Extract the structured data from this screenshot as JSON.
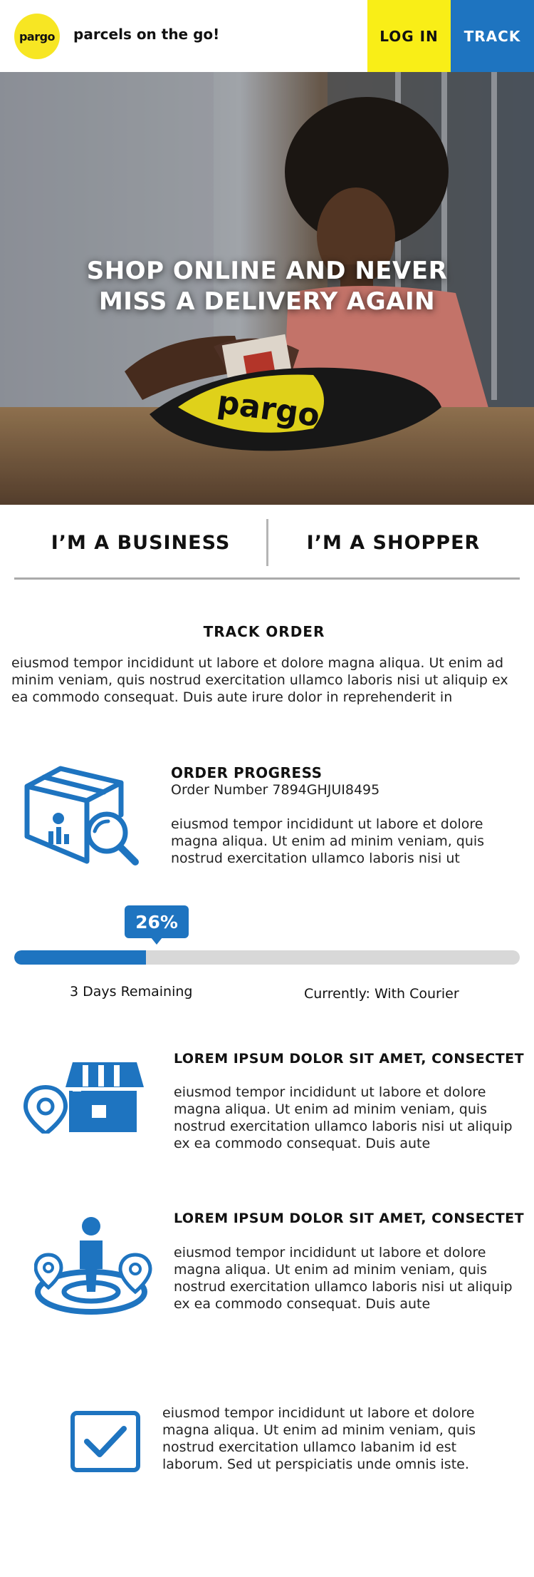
{
  "header": {
    "logo_text": "pargo",
    "tagline": "parcels on the go!",
    "login_label": "LOG IN",
    "track_label": "TRACK"
  },
  "hero": {
    "headline_line1": "SHOP ONLINE AND NEVER",
    "headline_line2": "MISS A DELIVERY AGAIN",
    "parcel_text": "pargo"
  },
  "segments": {
    "business_label": "I’M A BUSINESS",
    "shopper_label": "I’M A SHOPPER"
  },
  "track_order": {
    "title": "TRACK ORDER",
    "intro": "eiusmod tempor incididunt ut labore et dolore magna aliqua. Ut enim ad minim veniam, quis nostrud exercitation ullamco laboris nisi ut aliquip ex ea commodo consequat. Duis aute irure dolor in reprehenderit in"
  },
  "order": {
    "heading": "ORDER PROGRESS",
    "number": "Order Number 7894GHJUI8495",
    "text": "eiusmod tempor incididunt ut labore et dolore magna aliqua. Ut enim ad minim veniam, quis nostrud exercitation ullamco laboris nisi ut"
  },
  "progress": {
    "percent_label": "26%",
    "value": 0.26,
    "days_remaining": "3 Days Remaining",
    "status": "Currently: With Courier"
  },
  "features": [
    {
      "icon": "store-location-icon",
      "heading": "LOREM IPSUM DOLOR SIT AMET, CONSECTET",
      "text": "eiusmod tempor incididunt ut labore et dolore magna aliqua. Ut enim ad minim veniam, quis nostrud exercitation ullamco laboris nisi ut aliquip ex ea commodo consequat. Duis aute"
    },
    {
      "icon": "person-location-icon",
      "heading": "LOREM IPSUM DOLOR SIT AMET, CONSECTET",
      "text": "eiusmod tempor incididunt ut labore et dolore magna aliqua. Ut enim ad minim veniam, quis nostrud exercitation ullamco laboris nisi ut aliquip ex ea commodo consequat. Duis aute"
    }
  ],
  "confirmation": {
    "icon": "checkbox-icon",
    "text": "eiusmod tempor incididunt ut labore et dolore magna aliqua. Ut enim ad minim veniam, quis nostrud exercitation ullamco labanim id est laborum. Sed ut perspiciatis unde omnis iste."
  },
  "colors": {
    "brand_yellow": "#f9ee17",
    "brand_blue": "#1e74c0",
    "track_grey": "#d8d8d8"
  }
}
